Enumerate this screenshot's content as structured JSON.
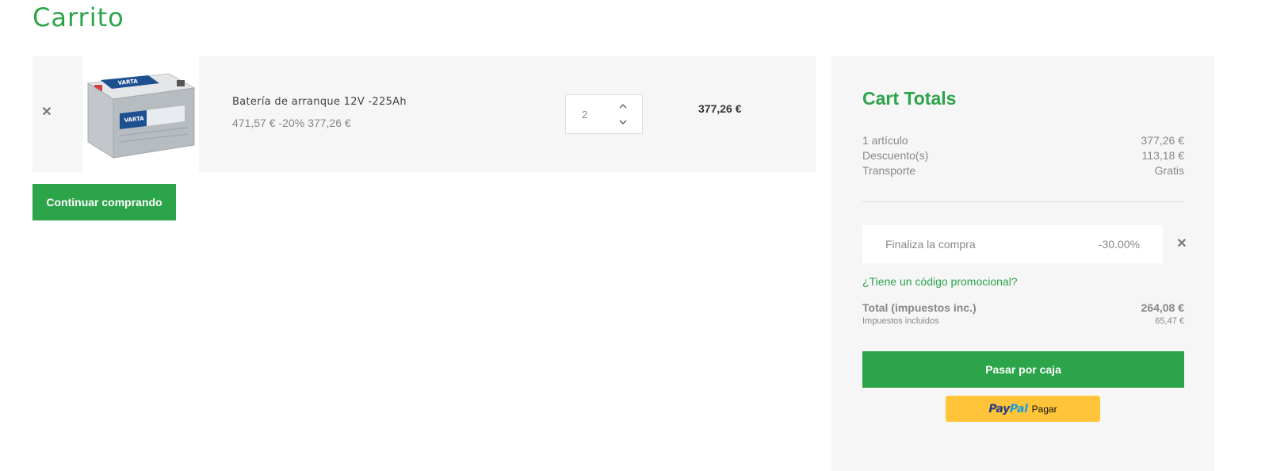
{
  "page": {
    "title": "Carrito"
  },
  "cart": {
    "items": [
      {
        "name": "Batería de arranque 12V -225Ah",
        "image_alt": "VARTA",
        "regular_price": "471,57 €",
        "discount": "-20%",
        "price": "377,26 €",
        "quantity": "2",
        "line_total": "377,26 €"
      }
    ],
    "continue_label": "Continuar comprando"
  },
  "totals": {
    "title": "Cart Totals",
    "rows": [
      {
        "label": "1 artículo",
        "value": "377,26 €"
      },
      {
        "label": "Descuento(s)",
        "value": "113,18 €"
      },
      {
        "label": "Transporte",
        "value": "Gratis"
      }
    ],
    "voucher": {
      "name": "Finaliza la compra",
      "amount": "-30.00%"
    },
    "promo_link": "¿Tiene un código promocional?",
    "total_label": "Total (impuestos inc.)",
    "total_value": "264,08 €",
    "tax_label": "Impuestos incluidos",
    "tax_value": "65,47 €",
    "checkout_label": "Pasar por caja",
    "paypal": {
      "logo_dark": "Pay",
      "logo_light": "Pal",
      "label": "Pagar"
    }
  },
  "colors": {
    "accent": "#2ca44a",
    "panel": "#f6f6f6",
    "paypal": "#ffc439"
  },
  "icons": {
    "remove": "close-icon",
    "qty_up": "chevron-up-icon",
    "qty_down": "chevron-down-icon"
  }
}
